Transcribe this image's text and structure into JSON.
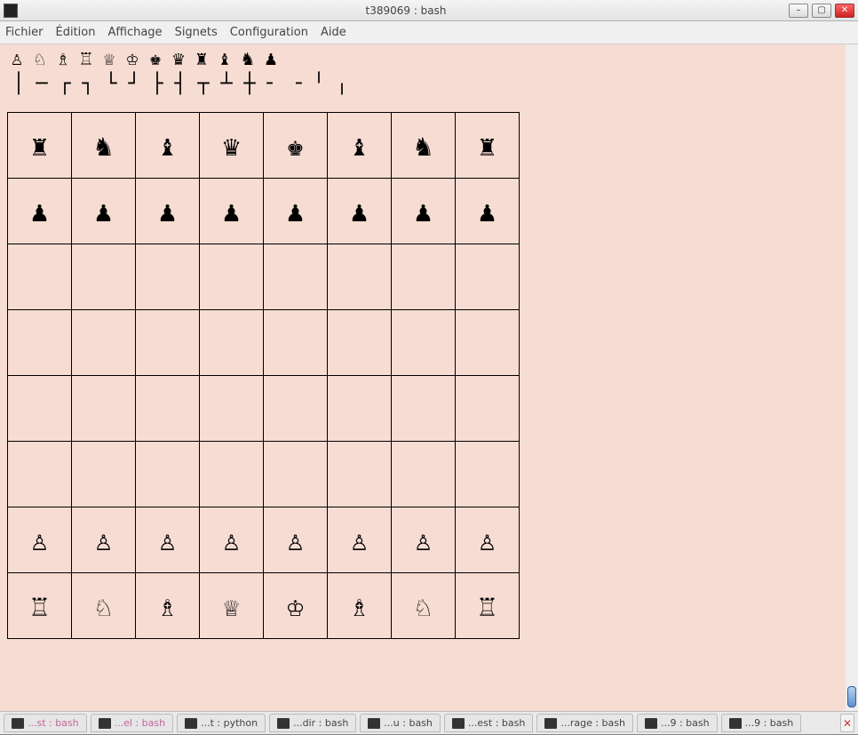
{
  "titlebar": {
    "title": "t389069 : bash"
  },
  "menu": {
    "fichier": "Fichier",
    "edition": "Édition",
    "affichage": "Affichage",
    "signets": "Signets",
    "configuration": "Configuration",
    "aide": "Aide"
  },
  "piece_legend": [
    "♙",
    "♘",
    "♗",
    "♖",
    "♕",
    "♔",
    "♚",
    "♛",
    "♜",
    "♝",
    "♞",
    "♟"
  ],
  "boxdraw": [
    "│",
    "─",
    "┌",
    "┐",
    "└",
    "┘",
    "├",
    "┤",
    "┬",
    "┴",
    "┼",
    "╴",
    "╶",
    "╵",
    "╷"
  ],
  "board_rows": [
    [
      "♜",
      "♞",
      "♝",
      "♛",
      "♚",
      "♝",
      "♞",
      "♜"
    ],
    [
      "♟",
      "♟",
      "♟",
      "♟",
      "♟",
      "♟",
      "♟",
      "♟"
    ],
    [
      "",
      "",
      "",
      "",
      "",
      "",
      "",
      ""
    ],
    [
      "",
      "",
      "",
      "",
      "",
      "",
      "",
      ""
    ],
    [
      "",
      "",
      "",
      "",
      "",
      "",
      "",
      ""
    ],
    [
      "",
      "",
      "",
      "",
      "",
      "",
      "",
      ""
    ],
    [
      "♙",
      "♙",
      "♙",
      "♙",
      "♙",
      "♙",
      "♙",
      "♙"
    ],
    [
      "♖",
      "♘",
      "♗",
      "♕",
      "♔",
      "♗",
      "♘",
      "♖"
    ]
  ],
  "tabs": [
    {
      "label": "...st : bash",
      "pink": true
    },
    {
      "label": "...el : bash",
      "pink": true
    },
    {
      "label": "...t : python",
      "pink": false
    },
    {
      "label": "...dir : bash",
      "pink": false
    },
    {
      "label": "...u : bash",
      "pink": false
    },
    {
      "label": "...est : bash",
      "pink": false
    },
    {
      "label": "...rage : bash",
      "pink": false
    },
    {
      "label": "...9 : bash",
      "pink": false
    },
    {
      "label": "...9 : bash",
      "pink": false
    }
  ]
}
